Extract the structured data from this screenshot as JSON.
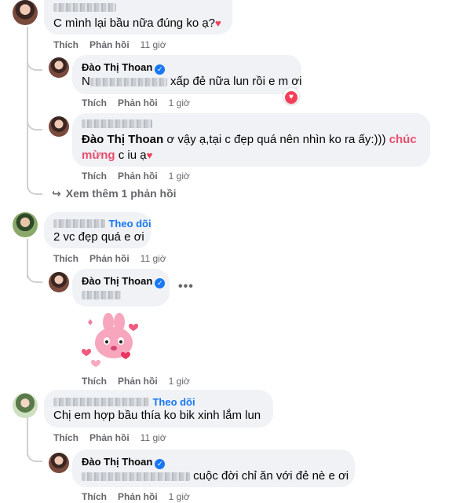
{
  "comments": [
    {
      "text": "C mình lại bầu nữa đúng ko ạ?",
      "actions": {
        "like": "Thích",
        "reply": "Phản hồi",
        "time": "11 giờ"
      }
    },
    {
      "author": "Đào Thị Thoan",
      "prefix": "N",
      "text": "xấp đẻ nữa lun rồi e m ơi",
      "actions": {
        "like": "Thích",
        "reply": "Phản hồi",
        "time": "1 giờ"
      }
    },
    {
      "author": "Đào Thị Thoan",
      "text_a": "ơ vậy ạ,tại c đẹp quá nên nhìn ko ra ấy:)))",
      "highlight": "chúc mừng",
      "text_b": "c iu ạ",
      "actions": {
        "like": "Thích",
        "reply": "Phản hồi",
        "time": "1 giờ"
      }
    },
    {
      "follow": "Theo dõi",
      "text": "2 vc đẹp quá e ơi",
      "actions": {
        "like": "Thích",
        "reply": "Phản hồi",
        "time": "11 giờ"
      }
    },
    {
      "author": "Đào Thị Thoan",
      "actions": {
        "like": "Thích",
        "reply": "Phản hồi",
        "time": "1 giờ"
      }
    },
    {
      "follow": "Theo dõi",
      "text": "Chị em hợp bầu thía ko bik xinh lắm lun",
      "actions": {
        "like": "Thích",
        "reply": "Phản hồi",
        "time": "11 giờ"
      }
    },
    {
      "author": "Đào Thị Thoan",
      "text": "cuộc đời chỉ ăn với đẻ nè e ơi",
      "actions": {
        "like": "Thích",
        "reply": "Phản hồi",
        "time": "1 giờ"
      }
    }
  ],
  "more_replies": "Xem thêm 1 phản hồi",
  "icons": {
    "heart": "heart-icon",
    "verified": "verified-badge-icon",
    "more": "more-options-icon",
    "reply_arrow": "reply-arrow-icon",
    "sticker": "bunny-sticker"
  },
  "colors": {
    "accent": "#1877f2",
    "highlight": "#e94e6d",
    "bubble": "#f0f2f5",
    "meta": "#65676b"
  }
}
